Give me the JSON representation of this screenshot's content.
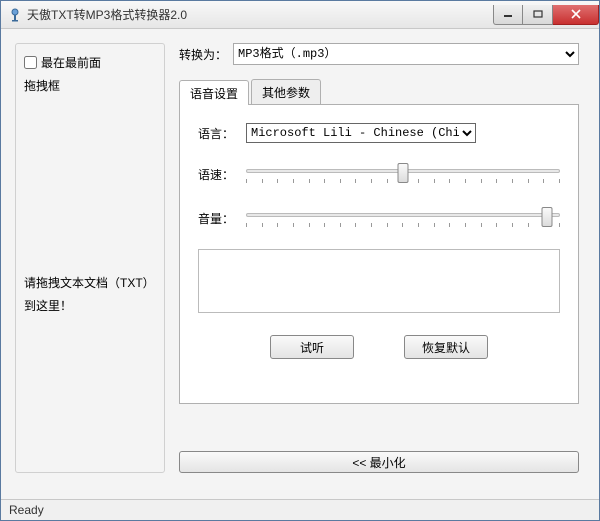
{
  "window": {
    "title": "天傲TXT转MP3格式转换器2.0"
  },
  "left": {
    "topmost_label": "最在最前面",
    "drag_frame_label": "拖拽框",
    "drag_hint_line1": "请拖拽文本文档（TXT）",
    "drag_hint_line2": "到这里！"
  },
  "convert": {
    "label": "转换为：",
    "selected": "MP3格式（.mp3）"
  },
  "tabs": {
    "voice": "语音设置",
    "other": "其他参数"
  },
  "voice": {
    "language_label": "语言：",
    "language_value": "Microsoft Lili - Chinese (China)",
    "speed_label": "语速：",
    "volume_label": "音量："
  },
  "buttons": {
    "preview": "试听",
    "reset": "恢复默认",
    "minimize": "<<  最小化"
  },
  "status": {
    "text": "Ready"
  },
  "chart_data": {
    "type": "table",
    "note": "no chart in image"
  }
}
